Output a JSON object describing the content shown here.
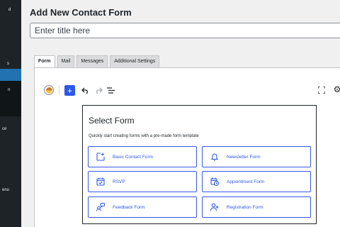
{
  "sidebar": {
    "fragments": [
      "d",
      "s",
      "n",
      "ce",
      "enu"
    ]
  },
  "header": {
    "title": "Add New Contact Form",
    "title_placeholder": "Enter title here"
  },
  "tabs": [
    {
      "label": "Form",
      "active": true
    },
    {
      "label": "Mail",
      "active": false
    },
    {
      "label": "Messages",
      "active": false
    },
    {
      "label": "Additional Settings",
      "active": false
    }
  ],
  "toolbar": {
    "add_label": "+",
    "undo_icon": "undo-icon",
    "redo_icon": "redo-icon",
    "list_icon": "list-view-icon",
    "fullscreen_icon": "fullscreen-icon",
    "settings_icon": "gear-icon"
  },
  "select_form": {
    "title": "Select Form",
    "subtitle": "Quickly start creating forms with a pre-made form template",
    "templates": [
      {
        "label": "Basic Contact Form",
        "icon": "new-form-icon"
      },
      {
        "label": "Newsletter Form",
        "icon": "bell-icon"
      },
      {
        "label": "RSVP",
        "icon": "calendar-check-icon"
      },
      {
        "label": "Appointment Form",
        "icon": "calendar-clock-icon"
      },
      {
        "label": "Feedback Form",
        "icon": "feedback-icon"
      },
      {
        "label": "Registration Form",
        "icon": "user-add-icon"
      }
    ]
  },
  "colors": {
    "sidebar_bg": "#1d2327",
    "sidebar_active": "#2271b1",
    "accent": "#2c59ea",
    "template_border": "#3858e9",
    "page_bg": "#f0f0f1"
  }
}
